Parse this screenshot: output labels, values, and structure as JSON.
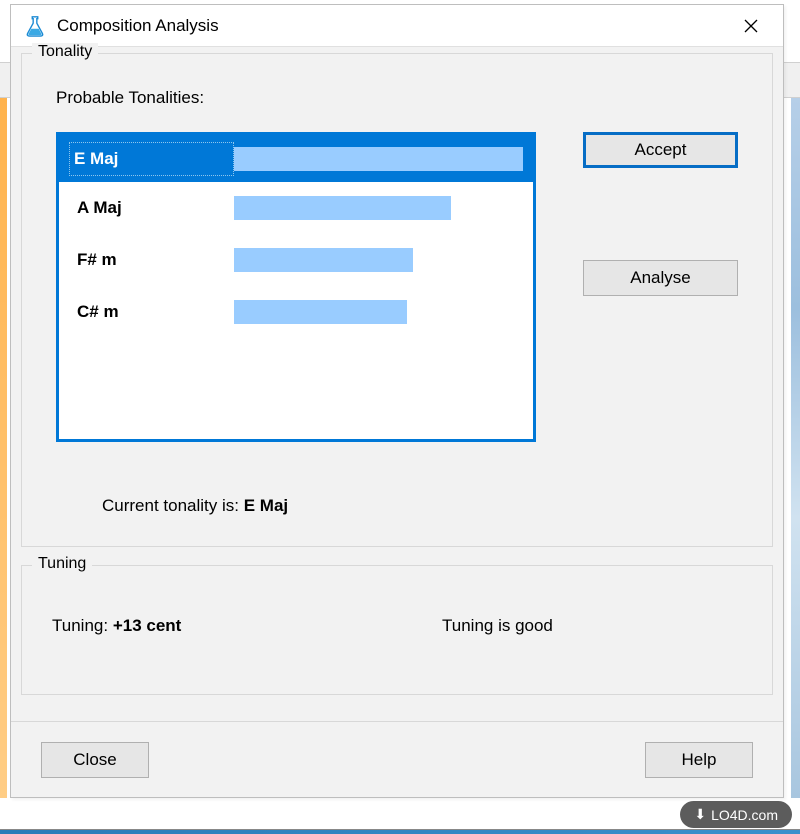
{
  "window": {
    "title": "Composition Analysis",
    "icon": "flask-icon"
  },
  "tonality": {
    "group_label": "Tonality",
    "probable_label": "Probable Tonalities:",
    "rows": [
      {
        "name": "E Maj",
        "bar_pct": 100,
        "selected": true
      },
      {
        "name": "A Maj",
        "bar_pct": 75,
        "selected": false
      },
      {
        "name": "F# m",
        "bar_pct": 62,
        "selected": false
      },
      {
        "name": "C# m",
        "bar_pct": 60,
        "selected": false
      }
    ],
    "accept_label": "Accept",
    "analyse_label": "Analyse",
    "current_label": "Current tonality is:",
    "current_value": "E Maj"
  },
  "tuning": {
    "group_label": "Tuning",
    "label": "Tuning:",
    "value": "+13 cent",
    "status": "Tuning is good"
  },
  "buttons": {
    "close": "Close",
    "help": "Help"
  },
  "watermark": "LO4D.com",
  "colors": {
    "selection": "#0078d7",
    "bar": "#99ccff"
  }
}
